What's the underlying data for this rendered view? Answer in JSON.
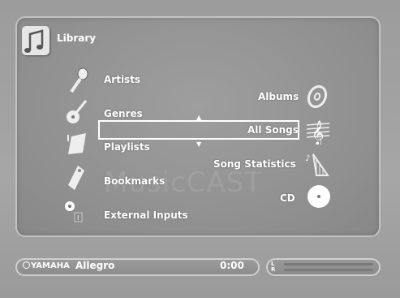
{
  "header": {
    "title": "Library",
    "icon": "music-note-icon"
  },
  "watermark": "MusicCAST",
  "left_menu": [
    {
      "label": "Artists",
      "icon": "microphone-icon"
    },
    {
      "label": "Genres",
      "icon": "guitar-icon"
    },
    {
      "label": "Playlists",
      "icon": "document-note-icon"
    },
    {
      "label": "Bookmarks",
      "icon": "tag-icon"
    },
    {
      "label": "External Inputs",
      "icon": "input-jack-icon"
    }
  ],
  "right_menu": [
    {
      "label": "Albums",
      "icon": "disc-icon"
    },
    {
      "label": "All Songs",
      "icon": "treble-clef-icon",
      "selected": true
    },
    {
      "label": "Song Statistics",
      "icon": "harp-icon"
    },
    {
      "label": "CD",
      "icon": "cd-icon"
    }
  ],
  "status_bar": {
    "brand": "YAMAHA",
    "track": "Allegro",
    "time": "0:00"
  },
  "level_meter": {
    "left_label": "L",
    "right_label": "R"
  }
}
